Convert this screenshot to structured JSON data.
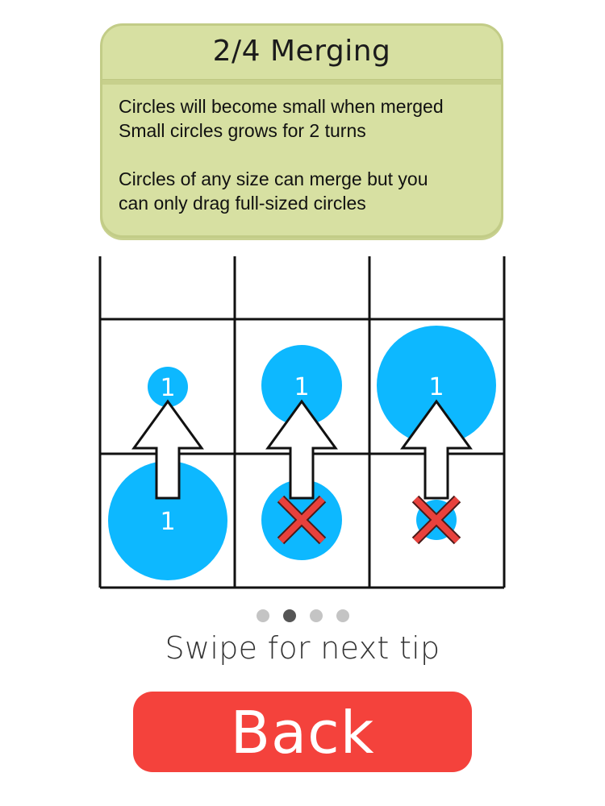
{
  "tip": {
    "title": "2/4 Merging",
    "lines_1": [
      "Circles will become small when merged",
      "Small circles grows for 2 turns"
    ],
    "lines_2": [
      "Circles of any size can merge but you",
      "can only drag full-sized circles"
    ]
  },
  "board": {
    "columns": 3,
    "rows_visible": 3,
    "circle_color": "#0db8ff",
    "cross_color": "#e8413c",
    "circle_value": "1",
    "examples": [
      {
        "top_circle_size": "small",
        "bottom_circle_size": "full",
        "allowed": true
      },
      {
        "top_circle_size": "medium",
        "bottom_circle_size": "medium",
        "allowed": false
      },
      {
        "top_circle_size": "full",
        "bottom_circle_size": "small",
        "allowed": false
      }
    ]
  },
  "pagination": {
    "total": 4,
    "current": 2
  },
  "swipe_hint": "Swipe for next tip",
  "back_button": {
    "label": "Back",
    "color": "#f4423c"
  }
}
